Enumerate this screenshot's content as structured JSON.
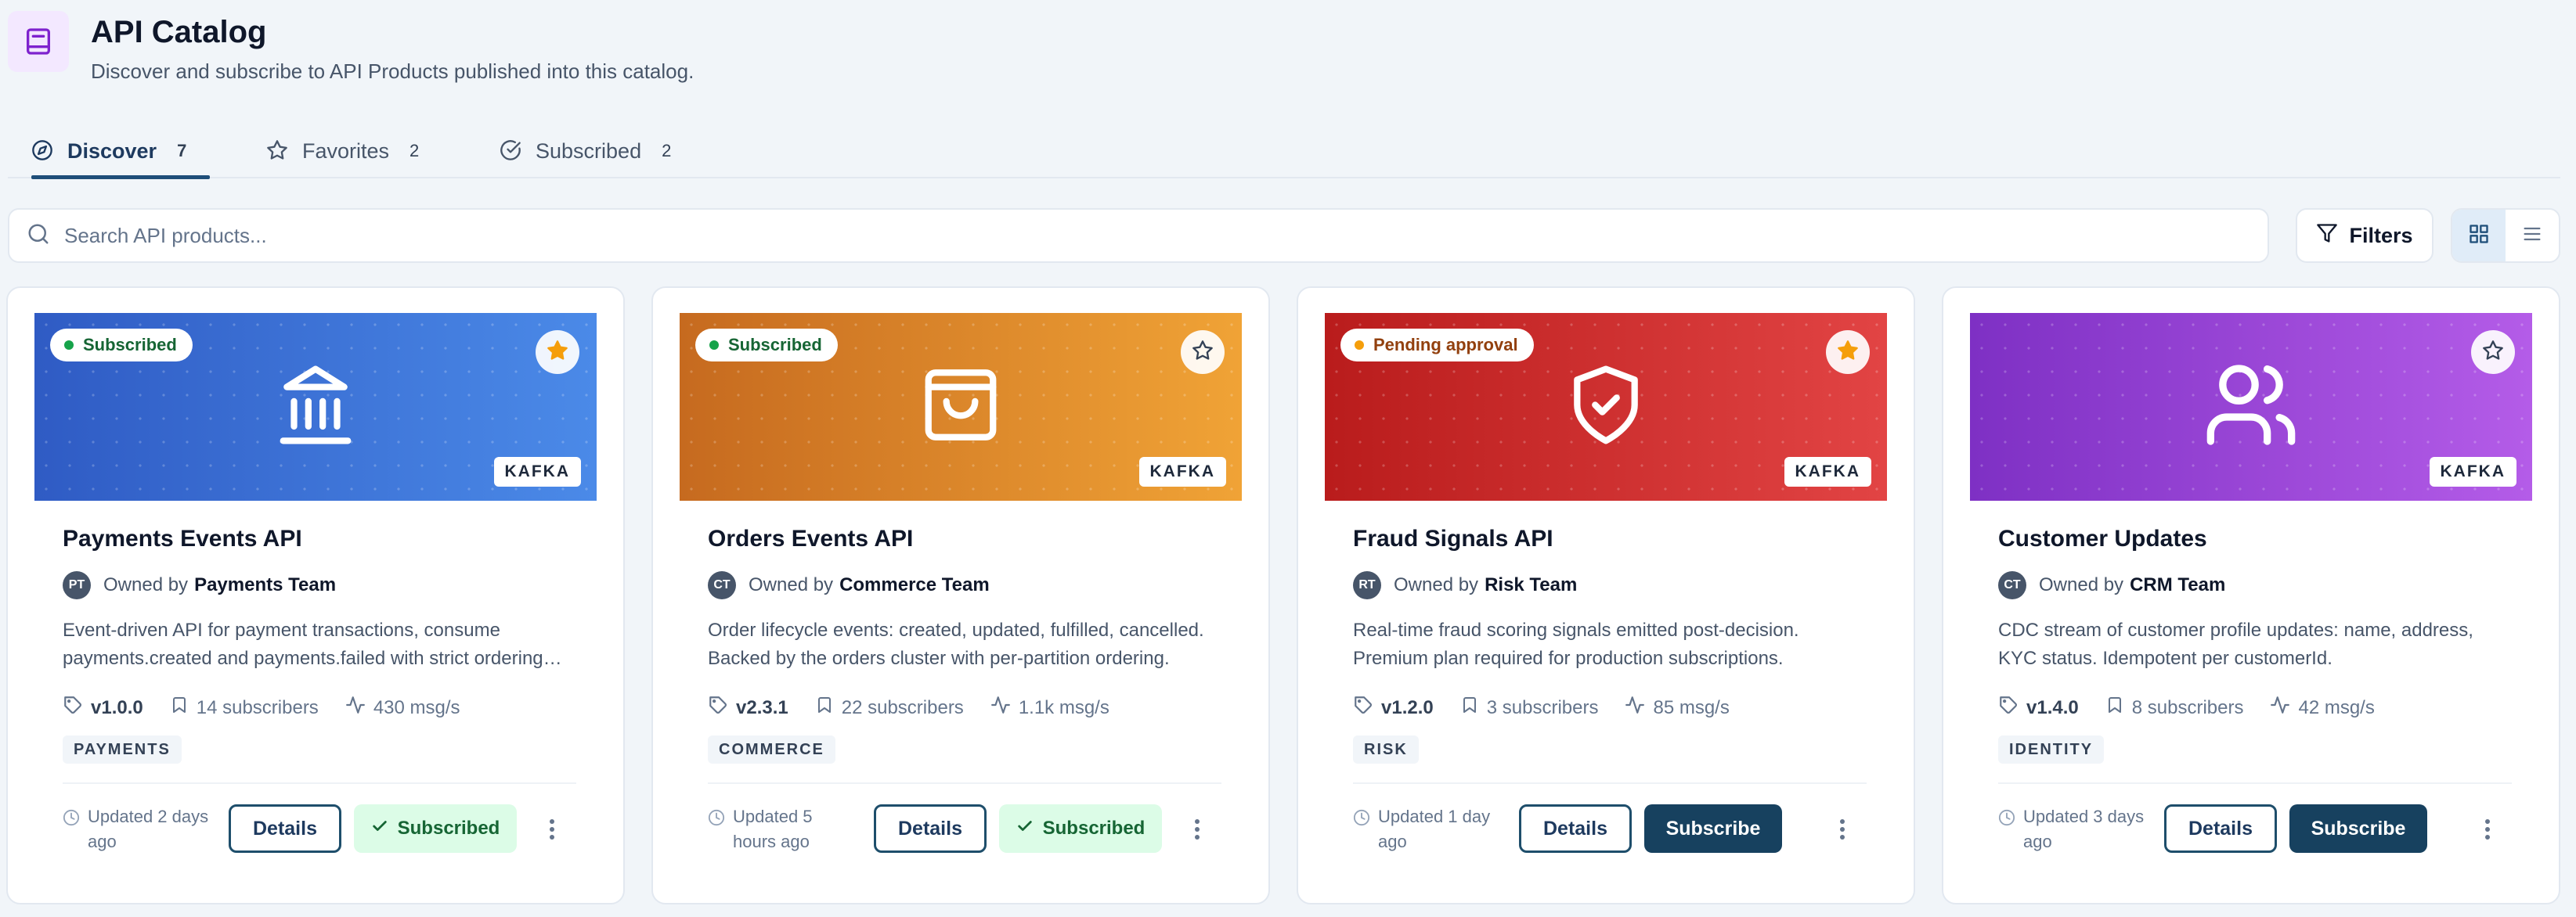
{
  "header": {
    "title": "API Catalog",
    "subtitle": "Discover and subscribe to API Products published into this catalog.",
    "icon": "book-icon",
    "icon_color": "#7e22ce"
  },
  "tabs": [
    {
      "label": "Discover",
      "count": "7",
      "icon": "compass-icon",
      "active": true
    },
    {
      "label": "Favorites",
      "count": "2",
      "icon": "star-icon",
      "active": false
    },
    {
      "label": "Subscribed",
      "count": "2",
      "icon": "check-circle-icon",
      "active": false
    }
  ],
  "search": {
    "placeholder": "Search API products...",
    "value": ""
  },
  "toolbar": {
    "filters_label": "Filters",
    "view_mode": "grid"
  },
  "cards": [
    {
      "title": "Payments Events API",
      "status": "Subscribed",
      "status_color": "#16a34a",
      "favorite": true,
      "protocol": "KAFKA",
      "banner_icon": "bank-icon",
      "banner_colors": [
        "#2f5bc4",
        "#4b8ae8"
      ],
      "owner_initials": "PT",
      "owner_prefix": "Owned by",
      "owner_team": "Payments Team",
      "description": "Event-driven API for payment transactions, consume payments.created and payments.failed with strict ordering guarantees.",
      "version": "v1.0.0",
      "subscribers": "14 subscribers",
      "throughput": "430 msg/s",
      "tag": "PAYMENTS",
      "updated": "Updated 2 days ago",
      "details_label": "Details",
      "action_label": "Subscribed",
      "action_state": "subscribed"
    },
    {
      "title": "Orders Events API",
      "status": "Subscribed",
      "status_color": "#16a34a",
      "favorite": false,
      "protocol": "KAFKA",
      "banner_icon": "shopping-bag-icon",
      "banner_colors": [
        "#c66a1f",
        "#f0a336"
      ],
      "owner_initials": "CT",
      "owner_prefix": "Owned by",
      "owner_team": "Commerce Team",
      "description": "Order lifecycle events: created, updated, fulfilled, cancelled. Backed by the orders cluster with per-partition ordering.",
      "version": "v2.3.1",
      "subscribers": "22 subscribers",
      "throughput": "1.1k msg/s",
      "tag": "COMMERCE",
      "updated": "Updated 5 hours ago",
      "details_label": "Details",
      "action_label": "Subscribed",
      "action_state": "subscribed"
    },
    {
      "title": "Fraud Signals API",
      "status": "Pending approval",
      "status_color": "#f59e0b",
      "favorite": true,
      "protocol": "KAFKA",
      "banner_icon": "shield-check-icon",
      "banner_colors": [
        "#b91c1c",
        "#e24444"
      ],
      "owner_initials": "RT",
      "owner_prefix": "Owned by",
      "owner_team": "Risk Team",
      "description": "Real-time fraud scoring signals emitted post-decision. Premium plan required for production subscriptions.",
      "version": "v1.2.0",
      "subscribers": "3 subscribers",
      "throughput": "85 msg/s",
      "tag": "RISK",
      "updated": "Updated 1 day ago",
      "details_label": "Details",
      "action_label": "Subscribe",
      "action_state": "subscribe"
    },
    {
      "title": "Customer Updates",
      "status": "",
      "status_color": "",
      "favorite": false,
      "protocol": "KAFKA",
      "banner_icon": "users-icon",
      "banner_colors": [
        "#7e30c4",
        "#b45ce8"
      ],
      "owner_initials": "CT",
      "owner_prefix": "Owned by",
      "owner_team": "CRM Team",
      "description": "CDC stream of customer profile updates: name, address, KYC status. Idempotent per customerId.",
      "version": "v1.4.0",
      "subscribers": "8 subscribers",
      "throughput": "42 msg/s",
      "tag": "IDENTITY",
      "updated": "Updated 3 days ago",
      "details_label": "Details",
      "action_label": "Subscribe",
      "action_state": "subscribe"
    }
  ]
}
